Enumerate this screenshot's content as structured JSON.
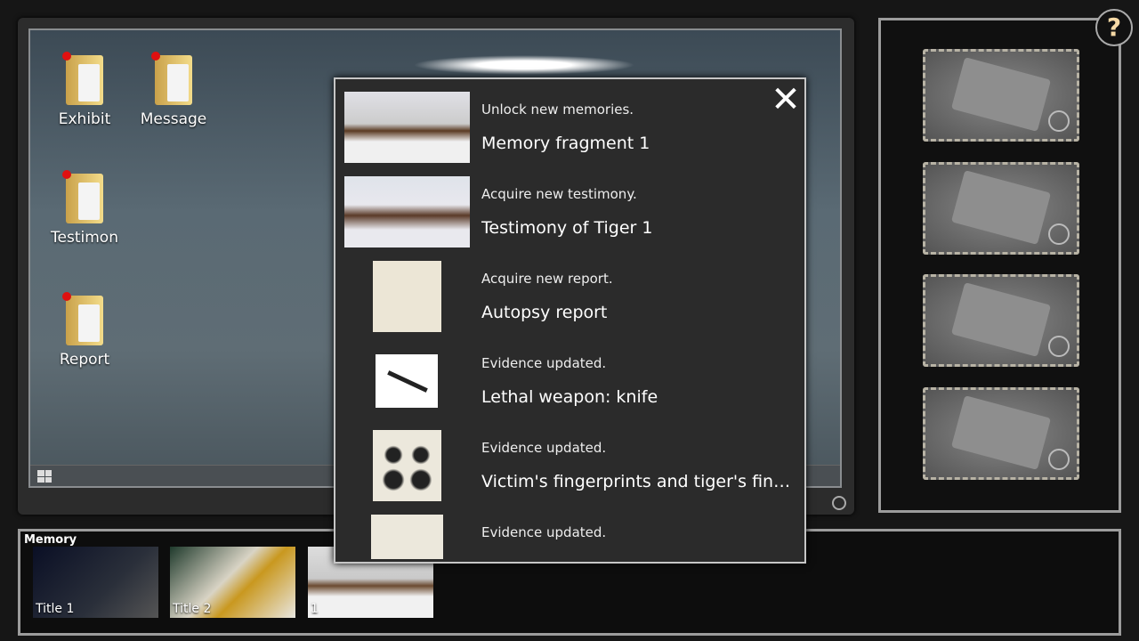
{
  "desktop": {
    "icons": [
      {
        "label": "Exhibit",
        "new": true
      },
      {
        "label": "Message",
        "new": true
      },
      {
        "label": "Testimon",
        "new": true
      },
      {
        "label": "Report",
        "new": true
      }
    ]
  },
  "help": {
    "label": "?"
  },
  "evidence_slots": 4,
  "memory": {
    "label": "Memory",
    "items": [
      {
        "label": "Title 1"
      },
      {
        "label": "Title 2"
      },
      {
        "label": "1"
      }
    ]
  },
  "popup": {
    "close": "✕",
    "items": [
      {
        "subtitle": "Unlock new memories.",
        "title": "Memory fragment 1"
      },
      {
        "subtitle": "Acquire new testimony.",
        "title": "Testimony of Tiger 1"
      },
      {
        "subtitle": "Acquire new report.",
        "title": "Autopsy report"
      },
      {
        "subtitle": "Evidence updated.",
        "title": "Lethal weapon: knife"
      },
      {
        "subtitle": "Evidence updated.",
        "title": "Victim's fingerprints and tiger's finger..."
      },
      {
        "subtitle": "Evidence updated.",
        "title": ""
      }
    ]
  }
}
